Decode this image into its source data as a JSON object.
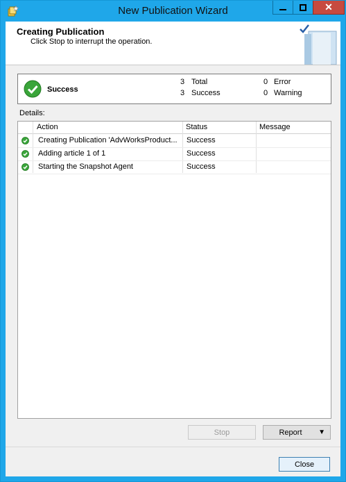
{
  "window": {
    "title": "New Publication Wizard",
    "minimize_label": "▁",
    "maximize_label": "□",
    "close_label": "✕"
  },
  "header": {
    "title": "Creating Publication",
    "subtitle": "Click Stop to interrupt the operation."
  },
  "summary": {
    "status": "Success",
    "total_count": "3",
    "total_label": "Total",
    "success_count": "3",
    "success_label": "Success",
    "error_count": "0",
    "error_label": "Error",
    "warning_count": "0",
    "warning_label": "Warning"
  },
  "details": {
    "label": "Details:",
    "columns": [
      "Action",
      "Status",
      "Message"
    ],
    "rows": [
      {
        "action": "Creating Publication 'AdvWorksProduct...",
        "status": "Success",
        "message": ""
      },
      {
        "action": "Adding article 1 of 1",
        "status": "Success",
        "message": ""
      },
      {
        "action": "Starting the Snapshot Agent",
        "status": "Success",
        "message": ""
      }
    ]
  },
  "buttons": {
    "stop": "Stop",
    "report": "Report",
    "report_arrow": "▼",
    "close": "Close"
  },
  "colors": {
    "titlebar": "#1fa7e9",
    "success_green": "#3aa53a",
    "close_button": "#c74a3f"
  }
}
